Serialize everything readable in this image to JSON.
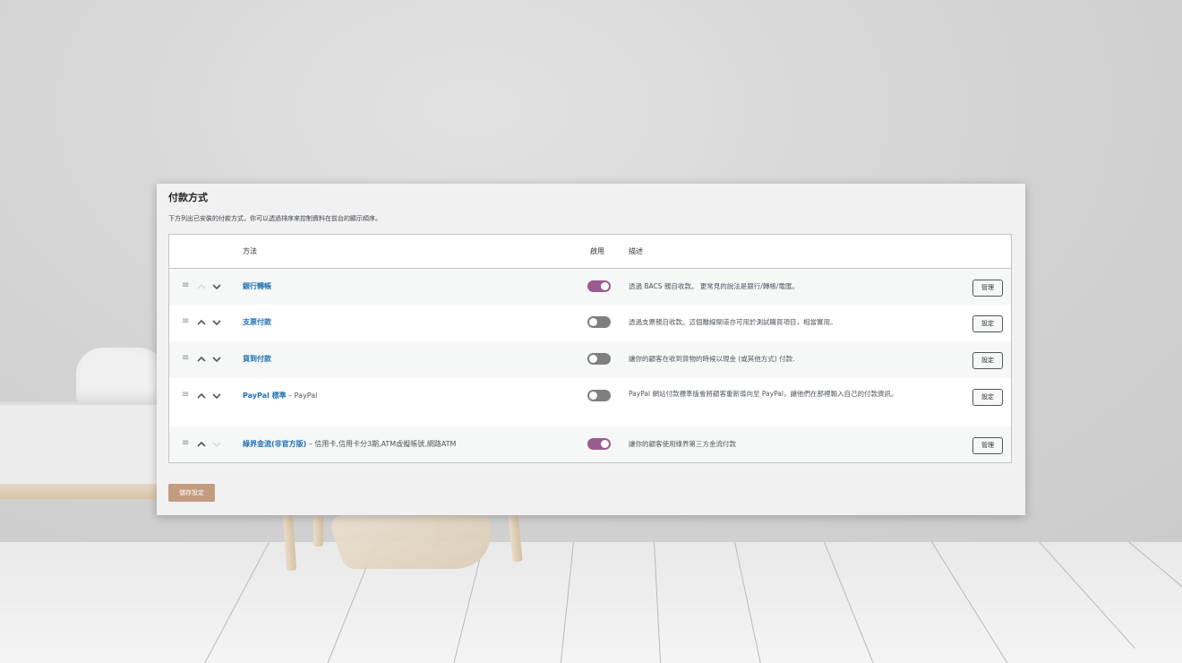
{
  "page": {
    "title": "付款方式",
    "description": "下方列出已安裝的付款方式，你可以透過排序來控制資料在前台的顯示順序。"
  },
  "table": {
    "headers": {
      "method": "方法",
      "enabled": "啟用",
      "description": "描述"
    },
    "rows": [
      {
        "name": "銀行轉帳",
        "suffix": "",
        "enabled": true,
        "description": "透過 BACS 親自收款。 更常見的說法是銀行/轉帳/電匯。",
        "button": "管理"
      },
      {
        "name": "支票付款",
        "suffix": "",
        "enabled": false,
        "description": "透過支票親自收款。這個離線閘道亦可用於測試購買項目，相當實用。",
        "button": "設定"
      },
      {
        "name": "貨到付款",
        "suffix": "",
        "enabled": false,
        "description": "讓你的顧客在收到貨物的時候以現金 (或其他方式) 付款.",
        "button": "設定"
      },
      {
        "name": "PayPal 標準",
        "suffix": " – PayPal",
        "enabled": false,
        "description": "PayPal 網站付款標準版會將顧客重新導向至 PayPal，讓他們在那裡輸入自己的付款資訊。",
        "button": "設定"
      },
      {
        "name": "綠界金流(非官方版)",
        "suffix": " – 信用卡,信用卡分3期,ATM虛擬帳號,網路ATM",
        "enabled": true,
        "description": "讓你的顧客使用綠界第三方金流付款",
        "button": "管理"
      }
    ]
  },
  "actions": {
    "save_label": "儲存設定"
  },
  "colors": {
    "toggle_on": "#9a5c8f",
    "toggle_off": "#7f7f7f",
    "link": "#2271b1",
    "save_button": "#c39b7e"
  },
  "icons": {
    "handle": "drag-handle-icon",
    "up": "chevron-up-icon",
    "down": "chevron-down-icon"
  }
}
